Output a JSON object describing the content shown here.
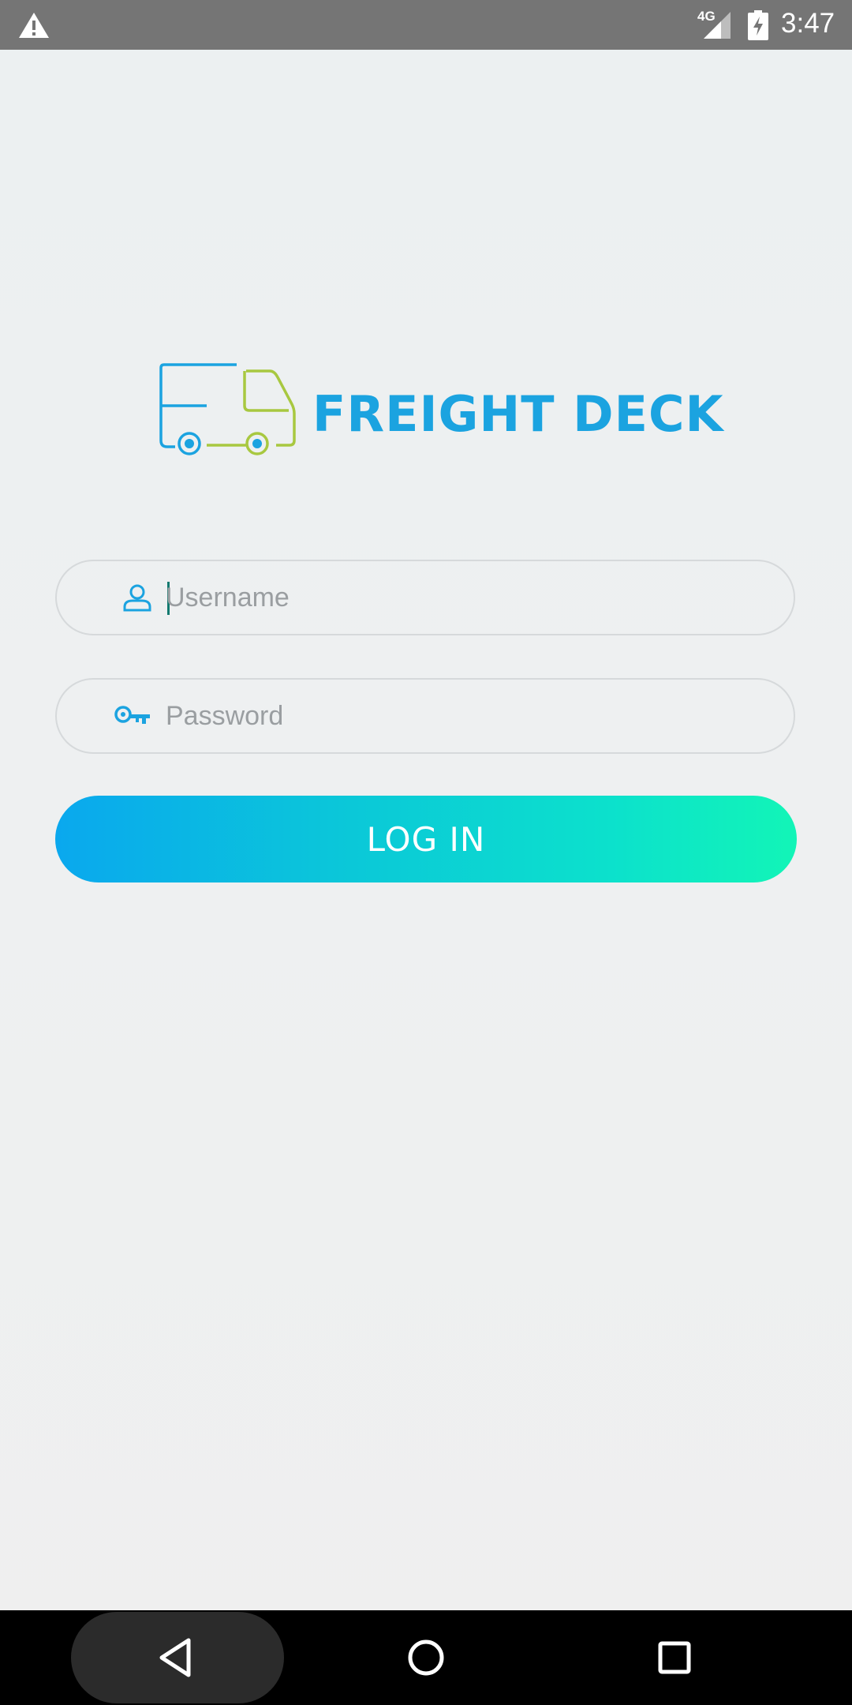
{
  "status_bar": {
    "network_label": "4G",
    "time": "3:47",
    "icons": [
      "warning-icon",
      "signal-icon",
      "battery-charging-icon"
    ]
  },
  "brand": {
    "name": "FREIGHT DECK",
    "logo_icon": "truck-icon",
    "colors": {
      "blue": "#1ba3e0",
      "green": "#a8c840"
    }
  },
  "login": {
    "username": {
      "placeholder": "Username",
      "value": "",
      "icon": "user-icon"
    },
    "password": {
      "placeholder": "Password",
      "value": "",
      "icon": "key-icon"
    },
    "submit_label": "LOG IN",
    "button_gradient": [
      "#0aa8ee",
      "#12f5b7"
    ]
  },
  "nav_bar": {
    "icons": [
      "back-icon",
      "home-icon",
      "recents-icon"
    ]
  }
}
